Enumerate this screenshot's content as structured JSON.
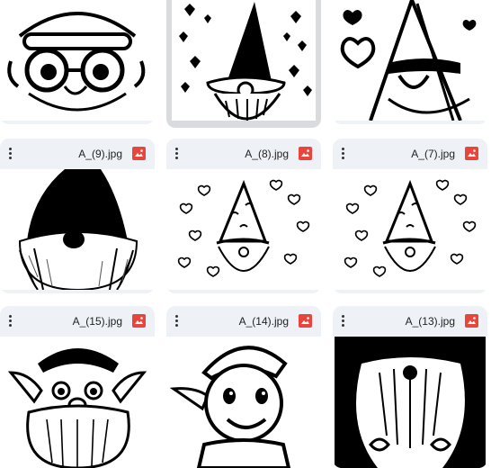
{
  "files": [
    {
      "name": ""
    },
    {
      "name": ""
    },
    {
      "name": ""
    },
    {
      "name": "A_(9).jpg"
    },
    {
      "name": "A_(8).jpg"
    },
    {
      "name": "A_(7).jpg"
    },
    {
      "name": "A_(15).jpg"
    },
    {
      "name": "A_(14).jpg"
    },
    {
      "name": "A_(13).jpg"
    }
  ],
  "icons": {
    "menu": "more-vert-icon",
    "file_type": "image-icon"
  },
  "colors": {
    "card_bg": "#eef1f6",
    "selected_bg": "#d9dbde",
    "file_icon": "#e8453c"
  }
}
